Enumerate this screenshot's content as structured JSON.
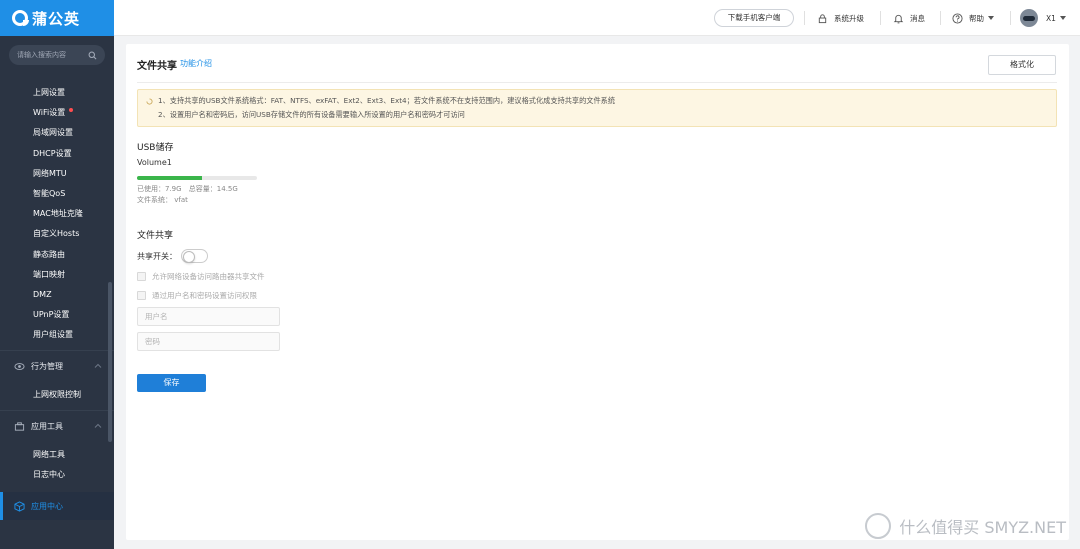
{
  "brand": {
    "name": "蒲公英"
  },
  "sidebar": {
    "search_placeholder": "请输入搜索内容",
    "network_items": [
      {
        "label": "上网设置"
      },
      {
        "label": "WiFi设置",
        "badge": true
      },
      {
        "label": "局域网设置"
      },
      {
        "label": "DHCP设置"
      },
      {
        "label": "网络MTU"
      },
      {
        "label": "智能QoS"
      },
      {
        "label": "MAC地址克隆"
      },
      {
        "label": "自定义Hosts"
      },
      {
        "label": "静态路由"
      },
      {
        "label": "端口映射"
      },
      {
        "label": "DMZ"
      },
      {
        "label": "UPnP设置"
      },
      {
        "label": "用户组设置"
      }
    ],
    "behavior_section": {
      "label": "行为管理",
      "items": [
        {
          "label": "上网权限控制"
        }
      ]
    },
    "tools_section": {
      "label": "应用工具",
      "items": [
        {
          "label": "网络工具"
        },
        {
          "label": "日志中心"
        }
      ]
    },
    "app_center": {
      "label": "应用中心"
    }
  },
  "header": {
    "download_label": "下载手机客户端",
    "upgrade_label": "系统升级",
    "messages_label": "消息",
    "help_label": "帮助",
    "device_label": "X1"
  },
  "page": {
    "title": "文件共享",
    "intro_link": "功能介绍",
    "format_button": "格式化",
    "notice": [
      "1、支持共享的USB文件系统格式：FAT、NTFS、exFAT、Ext2、Ext3、Ext4；若文件系统不在支持范围内，建议格式化成支持共享的文件系统",
      "2、设置用户名和密码后，访问USB存储文件的所有设备需要输入所设置的用户名和密码才可访问"
    ],
    "usb_title": "USB储存",
    "volume_name": "Volume1",
    "used_label": "已使用：7.9G",
    "total_label": "总容量：14.5G",
    "usage_fraction": 0.545,
    "filesystem_label": "文件系统：",
    "filesystem_value": "vfat",
    "share_title": "文件共享",
    "share_switch_label": "共享开关：",
    "share_switch_on": false,
    "allow_lan_label": "允许网络设备访问路由器共享文件",
    "auth_label": "通过用户名和密码设置访问权限",
    "username_placeholder": "用户名",
    "password_placeholder": "密码",
    "save_button": "保存"
  },
  "watermark": {
    "text": "什么值得买 SMYZ.NET"
  },
  "colors": {
    "accent": "#1f8fe6",
    "sidebar": "#2b3443",
    "progress": "#3ab54a",
    "notice_bg": "#fdf6e3"
  }
}
